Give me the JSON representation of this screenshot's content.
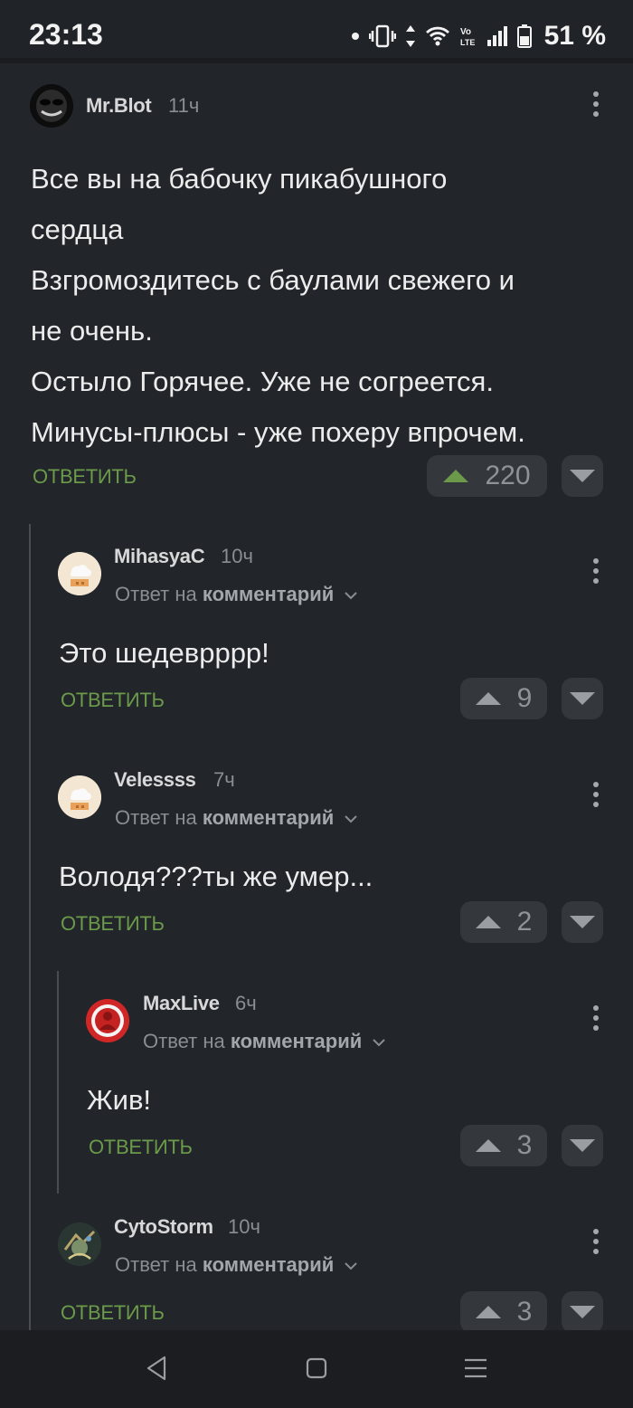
{
  "status_bar": {
    "time": "23:13",
    "battery": "51 %",
    "icons": [
      "dot-icon",
      "vibrate-icon",
      "data-arrows-icon",
      "wifi-icon",
      "volte-icon",
      "signal-icon",
      "battery-icon"
    ]
  },
  "comments": [
    {
      "author": "Mr.Blot",
      "time": "11ч",
      "lines": [
        "Все вы на бабочку пикабушного",
        "сердца",
        "Взгромоздитесь с баулами свежего и",
        "не очень.",
        "Остыло Горячее. Уже не согреется.",
        "Минусы-плюсы - уже похеру впрочем."
      ],
      "reply_label": "ОТВЕТИТЬ",
      "votes": "220"
    },
    {
      "author": "MihasyaC",
      "time": "10ч",
      "reply_prefix": "Ответ на",
      "reply_target": "комментарий",
      "text": "Это шедеврррр!",
      "reply_label": "ОТВЕТИТЬ",
      "votes": "9"
    },
    {
      "author": "Velessss",
      "time": "7ч",
      "reply_prefix": "Ответ на",
      "reply_target": "комментарий",
      "text": "Володя???ты же умер...",
      "reply_label": "ОТВЕТИТЬ",
      "votes": "2"
    },
    {
      "author": "MaxLive",
      "time": "6ч",
      "reply_prefix": "Ответ на",
      "reply_target": "комментарий",
      "text": "Жив!",
      "reply_label": "ОТВЕТИТЬ",
      "votes": "3"
    },
    {
      "author": "CytoStorm",
      "time": "10ч",
      "reply_prefix": "Ответ на",
      "reply_target": "комментарий",
      "reply_label": "ОТВЕТИТЬ",
      "votes": "3"
    }
  ],
  "colors": {
    "background": "#22262a",
    "accent_green": "#6b9a4a",
    "vote_button": "#34383d"
  },
  "nav_bar": {
    "icons": [
      "back-icon",
      "home-icon",
      "recents-icon"
    ]
  }
}
